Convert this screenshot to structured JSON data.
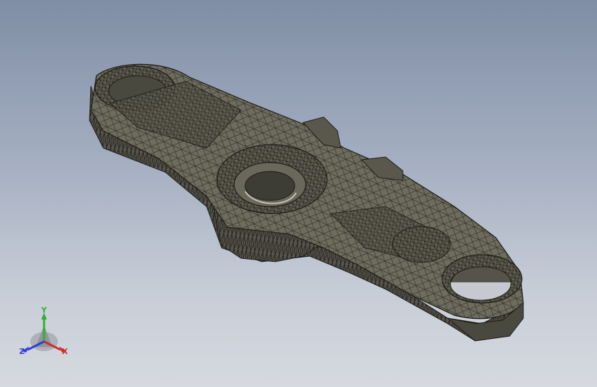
{
  "viewport": {
    "background_top": "#7f8ea5",
    "background_bottom": "#d6d9df"
  },
  "model": {
    "display_mode": "shaded-with-mesh-edges",
    "face_color": "#6d6b5c",
    "edge_color": "#1c1c18"
  },
  "triad": {
    "x_label": "X",
    "y_label": "Y",
    "z_label": "Z",
    "x_color": "#d42a2a",
    "y_color": "#2fb02f",
    "z_color": "#2a3fd4"
  }
}
